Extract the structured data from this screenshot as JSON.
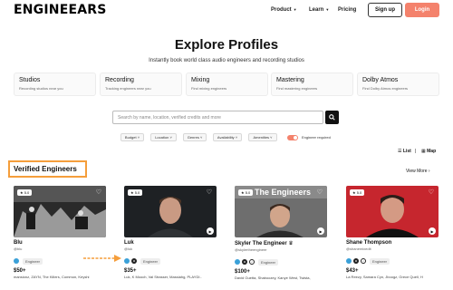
{
  "header": {
    "logo": "ENGINEEARS",
    "nav": [
      {
        "label": "Product",
        "dropdown": true
      },
      {
        "label": "Learn",
        "dropdown": true
      },
      {
        "label": "Pricing",
        "dropdown": false
      }
    ],
    "signup_label": "Sign up",
    "login_label": "Login"
  },
  "hero": {
    "title": "Explore Profiles",
    "subtitle": "Instantly book world class audio engineers and recording studios"
  },
  "categories": [
    {
      "title": "Studios",
      "desc": "Recording studios near you"
    },
    {
      "title": "Recording",
      "desc": "Tracking engineers near you"
    },
    {
      "title": "Mixing",
      "desc": "Find mixing engineers"
    },
    {
      "title": "Mastering",
      "desc": "Find mastering engineers"
    },
    {
      "title": "Dolby Atmos",
      "desc": "Find Dolby Atmos engineers"
    }
  ],
  "search": {
    "placeholder": "Search by name, location, verified credits and more"
  },
  "filters": [
    {
      "label": "Budget"
    },
    {
      "label": "Location"
    },
    {
      "label": "Genres"
    },
    {
      "label": "Availability"
    },
    {
      "label": "Amenities"
    }
  ],
  "engineer_toggle": {
    "label": "Engineer required",
    "on": true
  },
  "view": {
    "list_label": "List",
    "map_label": "Map",
    "separator": "|"
  },
  "section": {
    "title": "Verified Engineers",
    "view_more": "View More"
  },
  "cards": [
    {
      "name": "Blu",
      "handle": "@blu",
      "rating": "5.0",
      "price": "$50+",
      "credits": "mansionz, ZAYN, The Killers, Common, Keyshi",
      "chip": "Engineer",
      "has_play": false
    },
    {
      "name": "Luk",
      "handle": "@luk",
      "rating": "5.0",
      "price": "$35+",
      "credits": "Luk, K Mooch, Val Strasser, Massiahg, PLAYDI..",
      "chip": "Engineer",
      "has_play": true
    },
    {
      "name": "Skyler The Engineer",
      "handle": "@skylertheengineer",
      "rating": "5.0",
      "price": "$100+",
      "credits": "David Guetta, Shaboozey, Kanye West, Twista,",
      "chip": "Engineer",
      "has_play": true,
      "thumb_text": "The Engineers"
    },
    {
      "name": "Shane Thompson",
      "handle": "@shanemixedit",
      "rating": "5.0",
      "price": "$43+",
      "credits": "La Reezy, Samara Cyn, Jboogz, Grece Quell, H",
      "chip": "Engineer",
      "has_play": true
    }
  ],
  "colors": {
    "accent": "#f4826c",
    "highlight": "#f59e3b"
  }
}
